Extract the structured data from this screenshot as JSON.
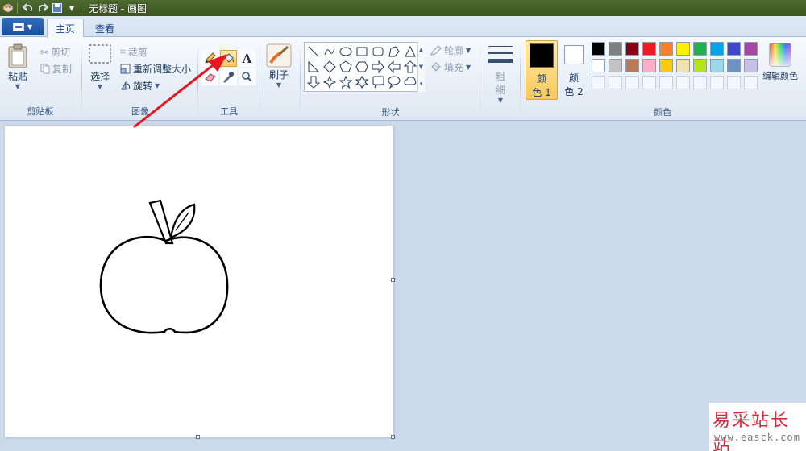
{
  "window": {
    "title": "无标题 - 画图"
  },
  "tabs": [
    {
      "label": "主页"
    },
    {
      "label": "查看"
    }
  ],
  "clipboard": {
    "paste": "粘贴",
    "cut": "剪切",
    "copy": "复制",
    "group_label": "剪贴板"
  },
  "image": {
    "select": "选择",
    "crop": "裁剪",
    "resize": "重新调整大小",
    "rotate": "旋转",
    "group_label": "图像"
  },
  "tools": {
    "group_label": "工具",
    "selected": "fill-bucket-icon",
    "icons": [
      "pencil-icon",
      "fill-bucket-icon",
      "text-icon",
      "eraser-icon",
      "color-picker-icon",
      "magnifier-icon"
    ]
  },
  "brushes": {
    "label": "刷子"
  },
  "shapes": {
    "outline": "轮廓",
    "fill": "填充",
    "group_label": "形状"
  },
  "size": {
    "label_1": "粗",
    "label_2": "细"
  },
  "colors": {
    "color1_label_1": "颜",
    "color1_label_2": "色 1",
    "color2_label_1": "颜",
    "color2_label_2": "色 2",
    "color1_value": "#000000",
    "color2_value": "#ffffff",
    "edit_colors": "编辑颜色",
    "group_label": "颜色",
    "palette_row1": [
      "#000000",
      "#7f7f7f",
      "#880015",
      "#ed1c24",
      "#ff7f27",
      "#fff200",
      "#22b14c",
      "#00a2e8",
      "#3f48cc",
      "#a349a4"
    ],
    "palette_row2": [
      "#ffffff",
      "#c3c3c3",
      "#b97a57",
      "#ffaec9",
      "#ffc90e",
      "#efe4b0",
      "#b5e61d",
      "#99d9ea",
      "#7092be",
      "#c8bfe7"
    ]
  },
  "annotation": {
    "arrow_color": "#e8161e"
  },
  "watermark": {
    "title": "易采站长站",
    "url": "www.easck.com"
  }
}
